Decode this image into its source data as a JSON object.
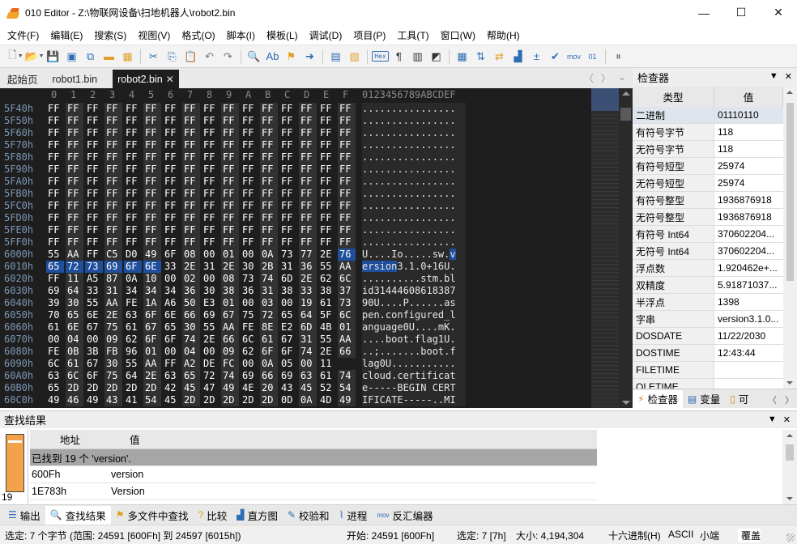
{
  "window": {
    "title": "010 Editor - Z:\\物联网设备\\扫地机器人\\robot2.bin",
    "minimize": "—",
    "maximize": "☐",
    "close": "✕"
  },
  "menu": [
    "文件(F)",
    "编辑(E)",
    "搜索(S)",
    "视图(V)",
    "格式(O)",
    "脚本(I)",
    "模板(L)",
    "调试(D)",
    "项目(P)",
    "工具(T)",
    "窗口(W)",
    "帮助(H)"
  ],
  "toolbar": {
    "hex_label": "Hex",
    "mov_label": "mov"
  },
  "tabs": [
    "起始页",
    "robot1.bin",
    "robot2.bin"
  ],
  "hex": {
    "header_cols": [
      "0",
      "1",
      "2",
      "3",
      "4",
      "5",
      "6",
      "7",
      "8",
      "9",
      "A",
      "B",
      "C",
      "D",
      "E",
      "F"
    ],
    "ascii_header": "0123456789ABCDEF",
    "rows": [
      {
        "addr": "5F40h",
        "bytes": [
          "FF",
          "FF",
          "FF",
          "FF",
          "FF",
          "FF",
          "FF",
          "FF",
          "FF",
          "FF",
          "FF",
          "FF",
          "FF",
          "FF",
          "FF",
          "FF"
        ],
        "ascii": "................"
      },
      {
        "addr": "5F50h",
        "bytes": [
          "FF",
          "FF",
          "FF",
          "FF",
          "FF",
          "FF",
          "FF",
          "FF",
          "FF",
          "FF",
          "FF",
          "FF",
          "FF",
          "FF",
          "FF",
          "FF"
        ],
        "ascii": "................"
      },
      {
        "addr": "5F60h",
        "bytes": [
          "FF",
          "FF",
          "FF",
          "FF",
          "FF",
          "FF",
          "FF",
          "FF",
          "FF",
          "FF",
          "FF",
          "FF",
          "FF",
          "FF",
          "FF",
          "FF"
        ],
        "ascii": "................"
      },
      {
        "addr": "5F70h",
        "bytes": [
          "FF",
          "FF",
          "FF",
          "FF",
          "FF",
          "FF",
          "FF",
          "FF",
          "FF",
          "FF",
          "FF",
          "FF",
          "FF",
          "FF",
          "FF",
          "FF"
        ],
        "ascii": "................"
      },
      {
        "addr": "5F80h",
        "bytes": [
          "FF",
          "FF",
          "FF",
          "FF",
          "FF",
          "FF",
          "FF",
          "FF",
          "FF",
          "FF",
          "FF",
          "FF",
          "FF",
          "FF",
          "FF",
          "FF"
        ],
        "ascii": "................"
      },
      {
        "addr": "5F90h",
        "bytes": [
          "FF",
          "FF",
          "FF",
          "FF",
          "FF",
          "FF",
          "FF",
          "FF",
          "FF",
          "FF",
          "FF",
          "FF",
          "FF",
          "FF",
          "FF",
          "FF"
        ],
        "ascii": "................"
      },
      {
        "addr": "5FA0h",
        "bytes": [
          "FF",
          "FF",
          "FF",
          "FF",
          "FF",
          "FF",
          "FF",
          "FF",
          "FF",
          "FF",
          "FF",
          "FF",
          "FF",
          "FF",
          "FF",
          "FF"
        ],
        "ascii": "................"
      },
      {
        "addr": "5FB0h",
        "bytes": [
          "FF",
          "FF",
          "FF",
          "FF",
          "FF",
          "FF",
          "FF",
          "FF",
          "FF",
          "FF",
          "FF",
          "FF",
          "FF",
          "FF",
          "FF",
          "FF"
        ],
        "ascii": "................"
      },
      {
        "addr": "5FC0h",
        "bytes": [
          "FF",
          "FF",
          "FF",
          "FF",
          "FF",
          "FF",
          "FF",
          "FF",
          "FF",
          "FF",
          "FF",
          "FF",
          "FF",
          "FF",
          "FF",
          "FF"
        ],
        "ascii": "................"
      },
      {
        "addr": "5FD0h",
        "bytes": [
          "FF",
          "FF",
          "FF",
          "FF",
          "FF",
          "FF",
          "FF",
          "FF",
          "FF",
          "FF",
          "FF",
          "FF",
          "FF",
          "FF",
          "FF",
          "FF"
        ],
        "ascii": "................"
      },
      {
        "addr": "5FE0h",
        "bytes": [
          "FF",
          "FF",
          "FF",
          "FF",
          "FF",
          "FF",
          "FF",
          "FF",
          "FF",
          "FF",
          "FF",
          "FF",
          "FF",
          "FF",
          "FF",
          "FF"
        ],
        "ascii": "................"
      },
      {
        "addr": "5FF0h",
        "bytes": [
          "FF",
          "FF",
          "FF",
          "FF",
          "FF",
          "FF",
          "FF",
          "FF",
          "FF",
          "FF",
          "FF",
          "FF",
          "FF",
          "FF",
          "FF",
          "FF"
        ],
        "ascii": "................"
      },
      {
        "addr": "6000h",
        "bytes": [
          "55",
          "AA",
          "FF",
          "C5",
          "D0",
          "49",
          "6F",
          "08",
          "00",
          "01",
          "00",
          "0A",
          "73",
          "77",
          "2E",
          "76"
        ],
        "ascii": "U....Io.....sw.v"
      },
      {
        "addr": "6010h",
        "bytes": [
          "65",
          "72",
          "73",
          "69",
          "6F",
          "6E",
          "33",
          "2E",
          "31",
          "2E",
          "30",
          "2B",
          "31",
          "36",
          "55",
          "AA"
        ],
        "ascii": "ersion3.1.0+16U."
      },
      {
        "addr": "6020h",
        "bytes": [
          "FF",
          "11",
          "A5",
          "87",
          "0A",
          "10",
          "00",
          "02",
          "00",
          "08",
          "73",
          "74",
          "6D",
          "2E",
          "62",
          "6C"
        ],
        "ascii": "..........stm.bl"
      },
      {
        "addr": "6030h",
        "bytes": [
          "69",
          "64",
          "33",
          "31",
          "34",
          "34",
          "34",
          "36",
          "30",
          "38",
          "36",
          "31",
          "38",
          "33",
          "38",
          "37"
        ],
        "ascii": "id31444608618387"
      },
      {
        "addr": "6040h",
        "bytes": [
          "39",
          "30",
          "55",
          "AA",
          "FE",
          "1A",
          "A6",
          "50",
          "E3",
          "01",
          "00",
          "03",
          "00",
          "19",
          "61",
          "73"
        ],
        "ascii": "90U....P......as"
      },
      {
        "addr": "6050h",
        "bytes": [
          "70",
          "65",
          "6E",
          "2E",
          "63",
          "6F",
          "6E",
          "66",
          "69",
          "67",
          "75",
          "72",
          "65",
          "64",
          "5F",
          "6C"
        ],
        "ascii": "pen.configured_l"
      },
      {
        "addr": "6060h",
        "bytes": [
          "61",
          "6E",
          "67",
          "75",
          "61",
          "67",
          "65",
          "30",
          "55",
          "AA",
          "FE",
          "8E",
          "E2",
          "6D",
          "4B",
          "01"
        ],
        "ascii": "anguage0U....mK."
      },
      {
        "addr": "6070h",
        "bytes": [
          "00",
          "04",
          "00",
          "09",
          "62",
          "6F",
          "6F",
          "74",
          "2E",
          "66",
          "6C",
          "61",
          "67",
          "31",
          "55",
          "AA"
        ],
        "ascii": "....boot.flag1U."
      },
      {
        "addr": "6080h",
        "bytes": [
          "FE",
          "0B",
          "3B",
          "FB",
          "96",
          "01",
          "00",
          "04",
          "00",
          "09",
          "62",
          "6F",
          "6F",
          "74",
          "2E",
          "66"
        ],
        "ascii": "..;.......boot.f"
      },
      {
        "addr": "6090h",
        "bytes": [
          "6C",
          "61",
          "67",
          "30",
          "55",
          "AA",
          "FF",
          "A2",
          "DE",
          "FC",
          "00",
          "0A",
          "05",
          "00",
          "11"
        ],
        "ascii": "lag0U..........."
      },
      {
        "addr": "60A0h",
        "bytes": [
          "63",
          "6C",
          "6F",
          "75",
          "64",
          "2E",
          "63",
          "65",
          "72",
          "74",
          "69",
          "66",
          "69",
          "63",
          "61",
          "74"
        ],
        "ascii": "cloud.certificat"
      },
      {
        "addr": "60B0h",
        "bytes": [
          "65",
          "2D",
          "2D",
          "2D",
          "2D",
          "2D",
          "42",
          "45",
          "47",
          "49",
          "4E",
          "20",
          "43",
          "45",
          "52",
          "54"
        ],
        "ascii": "e-----BEGIN CERT"
      },
      {
        "addr": "60C0h",
        "bytes": [
          "49",
          "46",
          "49",
          "43",
          "41",
          "54",
          "45",
          "2D",
          "2D",
          "2D",
          "2D",
          "2D",
          "0D",
          "0A",
          "4D",
          "49"
        ],
        "ascii": "IFICATE-----..MI"
      }
    ]
  },
  "inspector": {
    "title": "检查器",
    "col_type": "类型",
    "col_value": "值",
    "rows": [
      {
        "k": "二进制",
        "v": "01110110"
      },
      {
        "k": "有符号字节",
        "v": "118"
      },
      {
        "k": "无符号字节",
        "v": "118"
      },
      {
        "k": "有符号短型",
        "v": "25974"
      },
      {
        "k": "无符号短型",
        "v": "25974"
      },
      {
        "k": "有符号整型",
        "v": "1936876918"
      },
      {
        "k": "无符号整型",
        "v": "1936876918"
      },
      {
        "k": "有符号 Int64",
        "v": "370602204..."
      },
      {
        "k": "无符号 Int64",
        "v": "370602204..."
      },
      {
        "k": "浮点数",
        "v": "1.920462e+..."
      },
      {
        "k": "双精度",
        "v": "5.91871037..."
      },
      {
        "k": "半浮点",
        "v": "1398"
      },
      {
        "k": "字串",
        "v": "version3.1.0..."
      },
      {
        "k": "DOSDATE",
        "v": "11/22/2030"
      },
      {
        "k": "DOSTIME",
        "v": "12:43:44"
      },
      {
        "k": "FILETIME",
        "v": ""
      },
      {
        "k": "OLETIME",
        "v": ""
      }
    ],
    "tabs": [
      "检查器",
      "变量",
      "可"
    ]
  },
  "find": {
    "title": "查找结果",
    "count": "19",
    "col_addr": "地址",
    "col_value": "值",
    "summary": "已找到 19 个 'version'.",
    "results": [
      {
        "addr": "600Fh",
        "value": "version"
      },
      {
        "addr": "1E783h",
        "value": "Version"
      }
    ]
  },
  "bottom_tabs": [
    "输出",
    "查找结果",
    "多文件中查找",
    "比较",
    "直方图",
    "校验和",
    "进程",
    "反汇编器"
  ],
  "status": {
    "selection": "选定: 7 个字节 (范围: 24591 [600Fh] 到 24597 [6015h])",
    "start": "开始: 24591 [600Fh]",
    "selected": "选定: 7 [7h]",
    "size": "大小: 4,194,304",
    "mode": "十六进制(H)",
    "charset": "ASCII",
    "endian": "小端",
    "overwrite": "覆盖"
  },
  "colors": {
    "hex_bg": "#1e1e1e",
    "selection": "#1f4f9c",
    "address": "#7c96b4"
  }
}
